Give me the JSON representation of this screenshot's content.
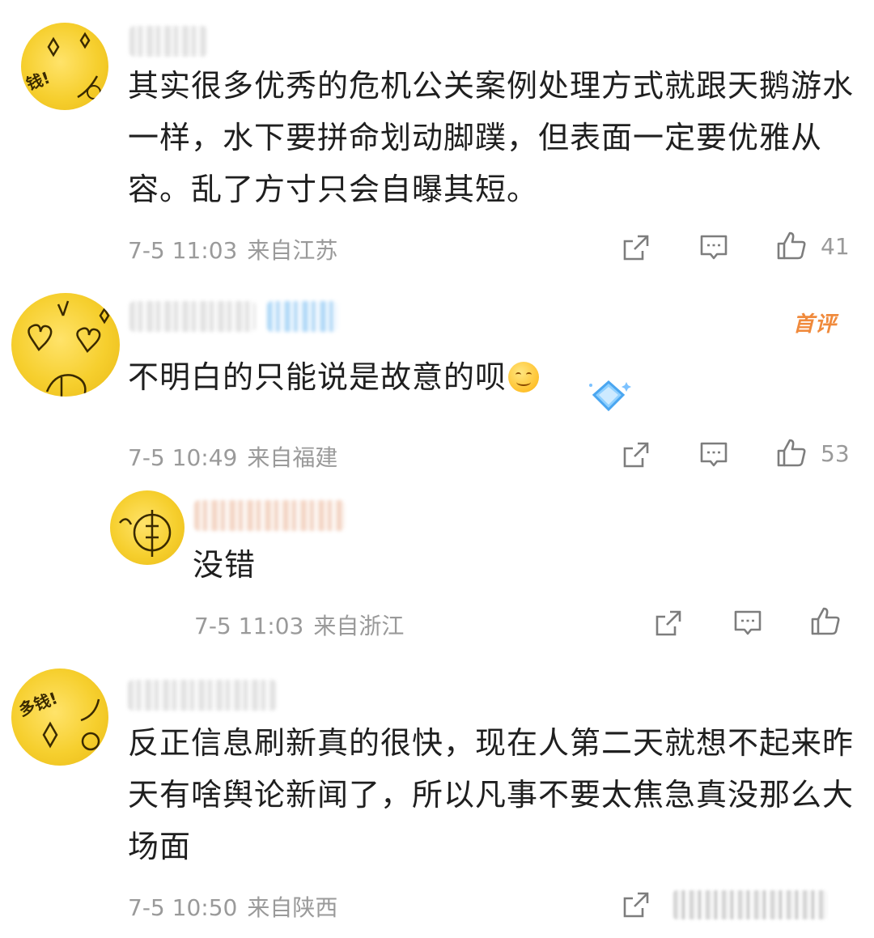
{
  "comments": [
    {
      "text": "其实很多优秀的危机公关案例处理方式就跟天鹅游水一样，水下要拼命划动脚蹼，但表面一定要优雅从容。乱了方寸只会自曝其短。",
      "time": "7-5 11:03",
      "location": "来自江苏",
      "likes": "41",
      "avatar_text": "钱!"
    },
    {
      "badge": "首评",
      "text": "不明白的只能说是故意的呗",
      "time": "7-5 10:49",
      "location": "来自福建",
      "likes": "53",
      "reply": {
        "text": "没错",
        "time": "7-5 11:03",
        "location": "来自浙江"
      }
    },
    {
      "text": "反正信息刷新真的很快，现在人第二天就想不起来昨天有啥舆论新闻了，所以凡事不要太焦急真没那么大场面",
      "time": "7-5 10:50",
      "location": "来自陕西",
      "avatar_text": "多钱!"
    }
  ],
  "icons": {
    "share": "share-icon",
    "comment": "comment-icon",
    "like": "thumbs-up-icon"
  },
  "colors": {
    "badge": "#f08a3c",
    "meta": "#9a9a9a",
    "avatar": "#f6cf2e"
  }
}
